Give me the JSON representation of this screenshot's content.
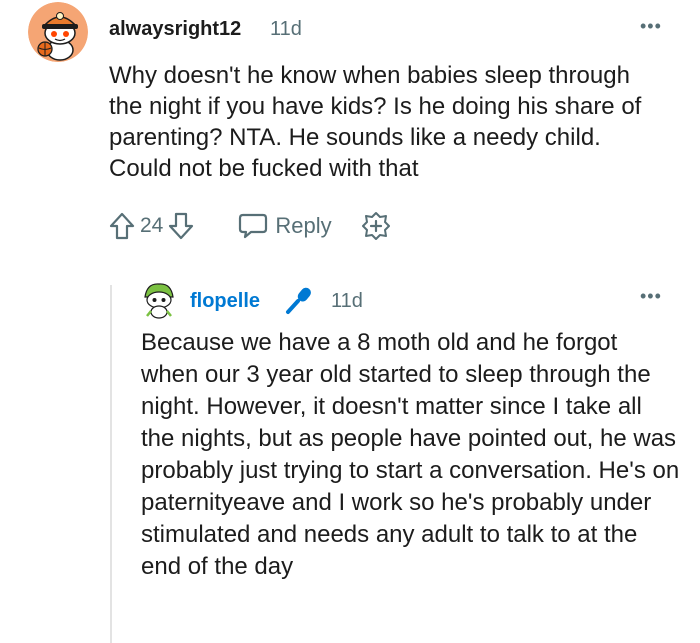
{
  "comment": {
    "username": "alwaysright12",
    "time": "11d",
    "more": "•••",
    "body": "Why doesn't he know when babies sleep through the night if you have kids? Is he doing his share of parenting? NTA. He sounds like a needy child. Could not be fucked with that",
    "score": "24",
    "reply_label": "Reply",
    "icons": [
      "upvote-icon",
      "downvote-icon",
      "reply-bubble-icon",
      "award-plus-icon",
      "more-options-icon"
    ],
    "colors": {
      "avatar_bg": "#f5a574",
      "meta": "#576f76",
      "text": "#1c1c1c"
    }
  },
  "reply": {
    "username": "flopelle",
    "time": "11d",
    "more": "•••",
    "body": "Because we have a 8 moth old and he forgot when our 3 year old started to sleep through the night. However, it doesn't matter since I take all the nights, but as people have pointed out, he was probably just trying to start a conversation. He's on paternityeave and I work so he's probably under stimulated and needs any adult to talk to at the end of the day",
    "icons": [
      "microphone-icon",
      "more-options-icon"
    ],
    "colors": {
      "username": "#0079d3",
      "mic": "#0079d3",
      "thread_line": "#e3e3e3"
    }
  }
}
